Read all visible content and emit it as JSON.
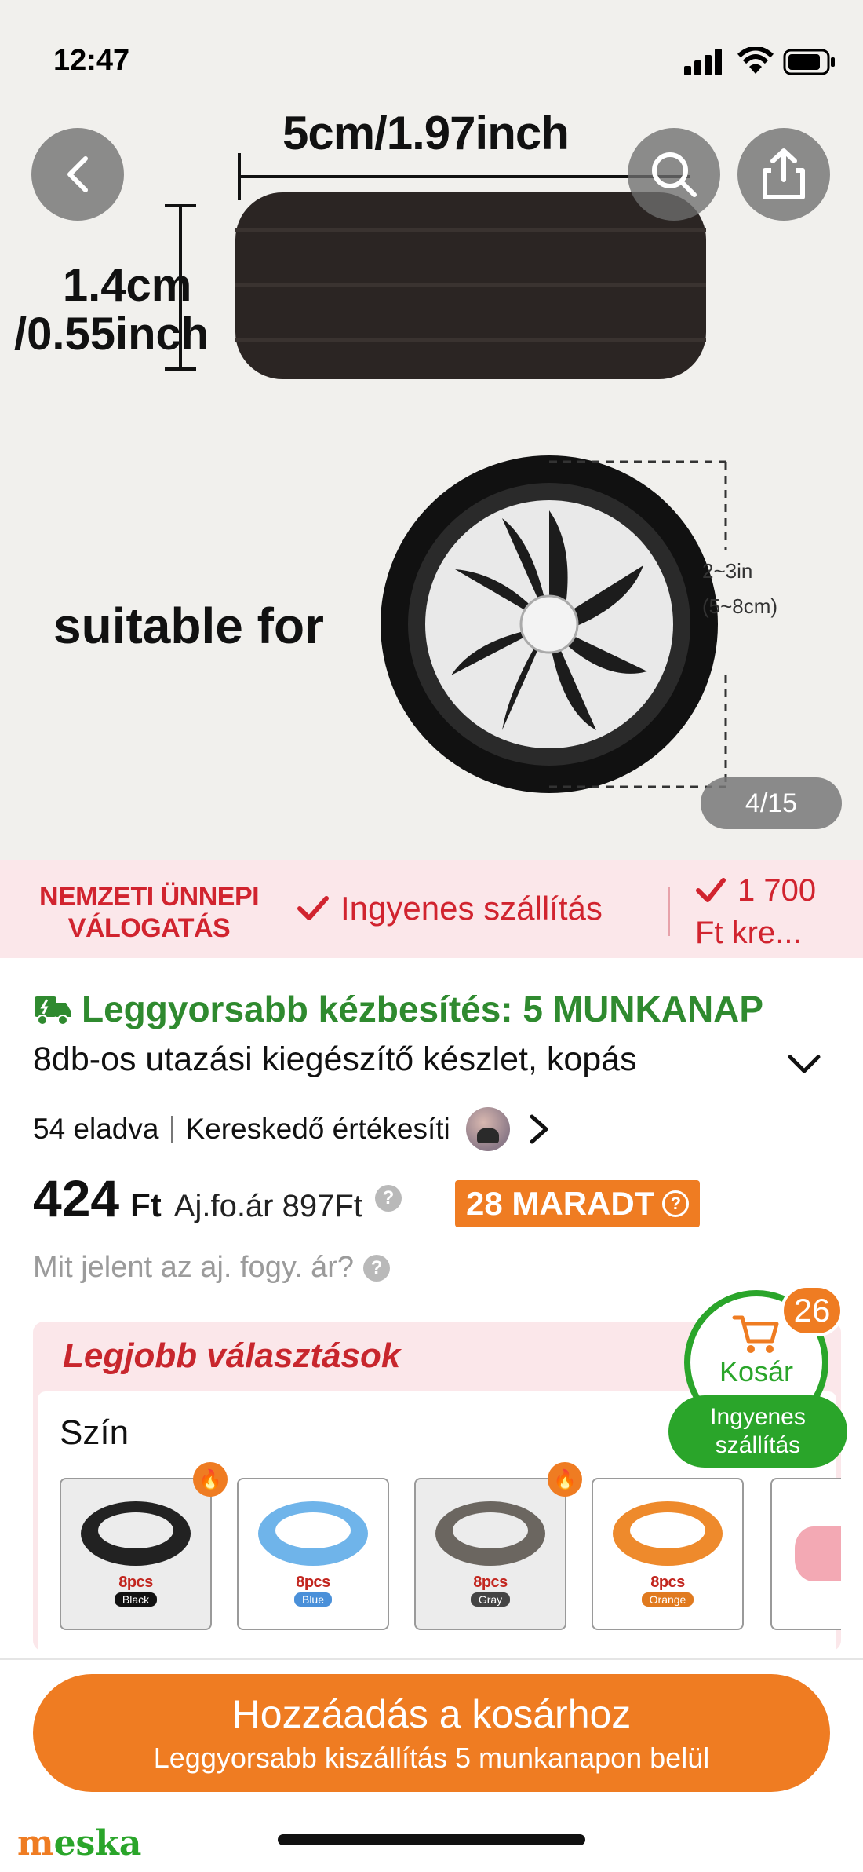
{
  "status_bar": {
    "time": "12:47"
  },
  "hero": {
    "dimension_width": "5cm/1.97inch",
    "dimension_height_line1": "1.4cm",
    "dimension_height_line2": "/0.55inch",
    "suitable_text": "suitable for",
    "wheel_size_line1": "2~3in",
    "wheel_size_line2": "(5~8cm)",
    "pager": "4/15",
    "back_icon": "chevron-left-icon",
    "search_icon": "search-icon",
    "share_icon": "share-icon"
  },
  "promo": {
    "brand_line1": "NEMZETI ÜNNEPI",
    "brand_line2": "VÁLOGATÁS",
    "shipping": "Ingyenes szállítás",
    "credit_line1": "1 700",
    "credit_line2": "Ft kre..."
  },
  "product": {
    "fast_delivery": "Leggyorsabb kézbesítés: 5 MUNKANAP",
    "title": "8db-os utazási kiegészítő készlet, kopás",
    "sold": "54 eladva",
    "seller_rating": "Kereskedő értékesíti",
    "price_value": "424",
    "price_currency": "Ft",
    "ref_price": "Aj.fo.ár 897Ft",
    "remaining_badge": "28 MARADT",
    "what_means": "Mit jelent az aj. fogy. ár?"
  },
  "best_choices": {
    "title": "Legjobb választások",
    "color_label": "Szín",
    "swatches": [
      {
        "count": "8pcs",
        "name": "Black",
        "color": "#222222",
        "pill": "#111111",
        "hot": true
      },
      {
        "count": "8pcs",
        "name": "Blue",
        "color": "#6fb4ea",
        "pill": "#4a90d9",
        "hot": false
      },
      {
        "count": "8pcs",
        "name": "Gray",
        "color": "#6b6660",
        "pill": "#444444",
        "hot": true
      },
      {
        "count": "8pcs",
        "name": "Orange",
        "color": "#ee8a2c",
        "pill": "#e07a1f",
        "hot": false
      }
    ]
  },
  "cart": {
    "label": "Kosár",
    "count": "26",
    "free_line1": "Ingyenes",
    "free_line2": "szállítás"
  },
  "cta": {
    "main": "Hozzáadás a kosárhoz",
    "sub": "Leggyorsabb kiszállítás 5 munkanapon belül"
  },
  "watermark": "meska",
  "colors": {
    "accent_orange": "#ef7c22",
    "promo_red": "#d1242f",
    "green": "#2aa52a"
  }
}
